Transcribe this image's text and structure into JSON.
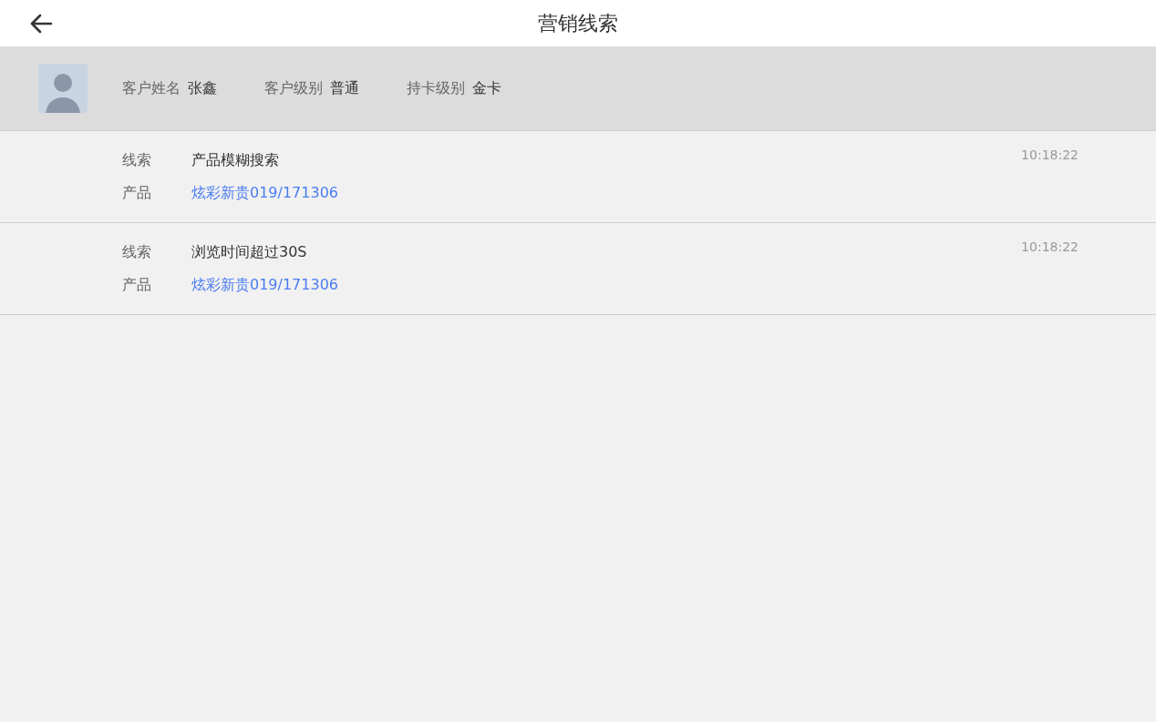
{
  "header": {
    "title": "营销线索"
  },
  "customer": {
    "fields": [
      {
        "label": "客户姓名",
        "value": "张鑫"
      },
      {
        "label": "客户级别",
        "value": "普通"
      },
      {
        "label": "持卡级别",
        "value": "金卡"
      }
    ]
  },
  "leads": [
    {
      "lead_label": "线索",
      "lead": "产品模糊搜索",
      "product_label": "产品",
      "product": "炫彩新贵019/171306",
      "time": "10:18:22"
    },
    {
      "lead_label": "线索",
      "lead": "浏览时间超过30S",
      "product_label": "产品",
      "product": "炫彩新贵019/171306",
      "time": "10:18:22"
    }
  ]
}
